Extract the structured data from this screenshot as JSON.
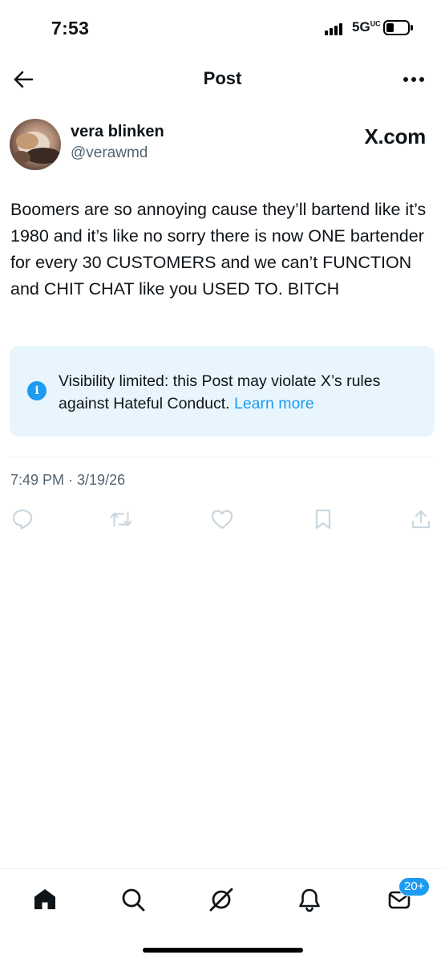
{
  "status_bar": {
    "time": "7:53",
    "network": "5G",
    "network_suffix": "UC",
    "battery_level": 0.25
  },
  "header": {
    "title": "Post",
    "back_icon": "arrow-left-icon",
    "more_icon": "ellipsis-icon"
  },
  "post": {
    "author": {
      "display_name": "vera blinken",
      "handle": "@verawmd"
    },
    "source_label": "X.com",
    "text": "Boomers are so annoying cause they’ll bartend like it’s 1980 and it’s like no sorry there is now ONE bartender for every 30 CUSTOMERS and we can’t FUNCTION and CHIT CHAT like you USED TO. BITCH",
    "notice": {
      "icon": "info-icon",
      "text": "Visibility limited: this Post may violate X’s rules against Hateful Conduct.",
      "link_text": "Learn more"
    },
    "timestamp": "7:49 PM · 3/19/26",
    "actions": [
      "reply-icon",
      "repost-icon",
      "like-icon",
      "bookmark-icon",
      "share-icon"
    ]
  },
  "bottom_nav": {
    "items": [
      "home-icon",
      "search-icon",
      "grok-icon",
      "notifications-icon",
      "messages-icon"
    ],
    "messages_badge": "20+"
  },
  "colors": {
    "accent": "#1d9bf0",
    "text_primary": "#0f1419",
    "text_secondary": "#536471",
    "notice_background": "#e8f5fd",
    "action_icon": "#c9d6de"
  }
}
